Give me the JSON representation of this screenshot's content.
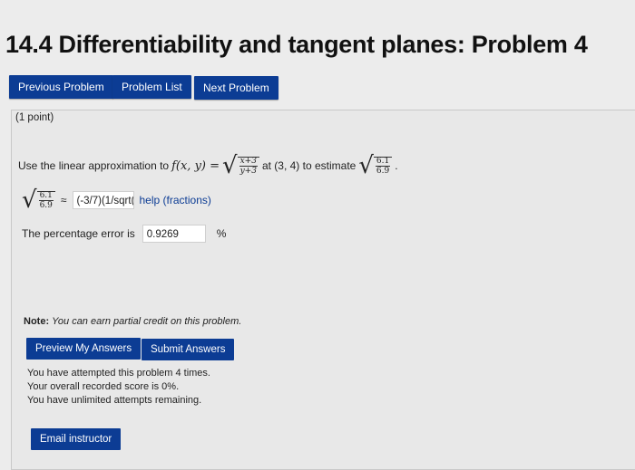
{
  "title": "14.4 Differentiability and tangent planes: Problem 4",
  "nav": {
    "previous": "Previous Problem",
    "list": "Problem List",
    "next": "Next Problem"
  },
  "problem": {
    "points": "(1 point)",
    "statement_prefix": "Use the linear approximation to",
    "function_lhs": "f(x, y) =",
    "func_num": "x+3",
    "func_den": "y+3",
    "at_text": "at (3, 4) to estimate",
    "est_num": "6.1",
    "est_den": "6.9",
    "approx_symbol": "≈",
    "answer_value": "(-3/7)(1/sqrt(",
    "help_label": "help (fractions)",
    "percent_label": "The percentage error is",
    "percent_value": "0.9269",
    "percent_unit": "%"
  },
  "note": {
    "bold": "Note:",
    "text": "You can earn partial credit on this problem."
  },
  "buttons": {
    "preview": "Preview My Answers",
    "submit": "Submit Answers",
    "email": "Email instructor"
  },
  "status": {
    "line1": "You have attempted this problem 4 times.",
    "line2": "Your overall recorded score is 0%.",
    "line3": "You have unlimited attempts remaining."
  },
  "colors": {
    "button_bg": "#0c3c94",
    "page_bg": "#ececec"
  }
}
